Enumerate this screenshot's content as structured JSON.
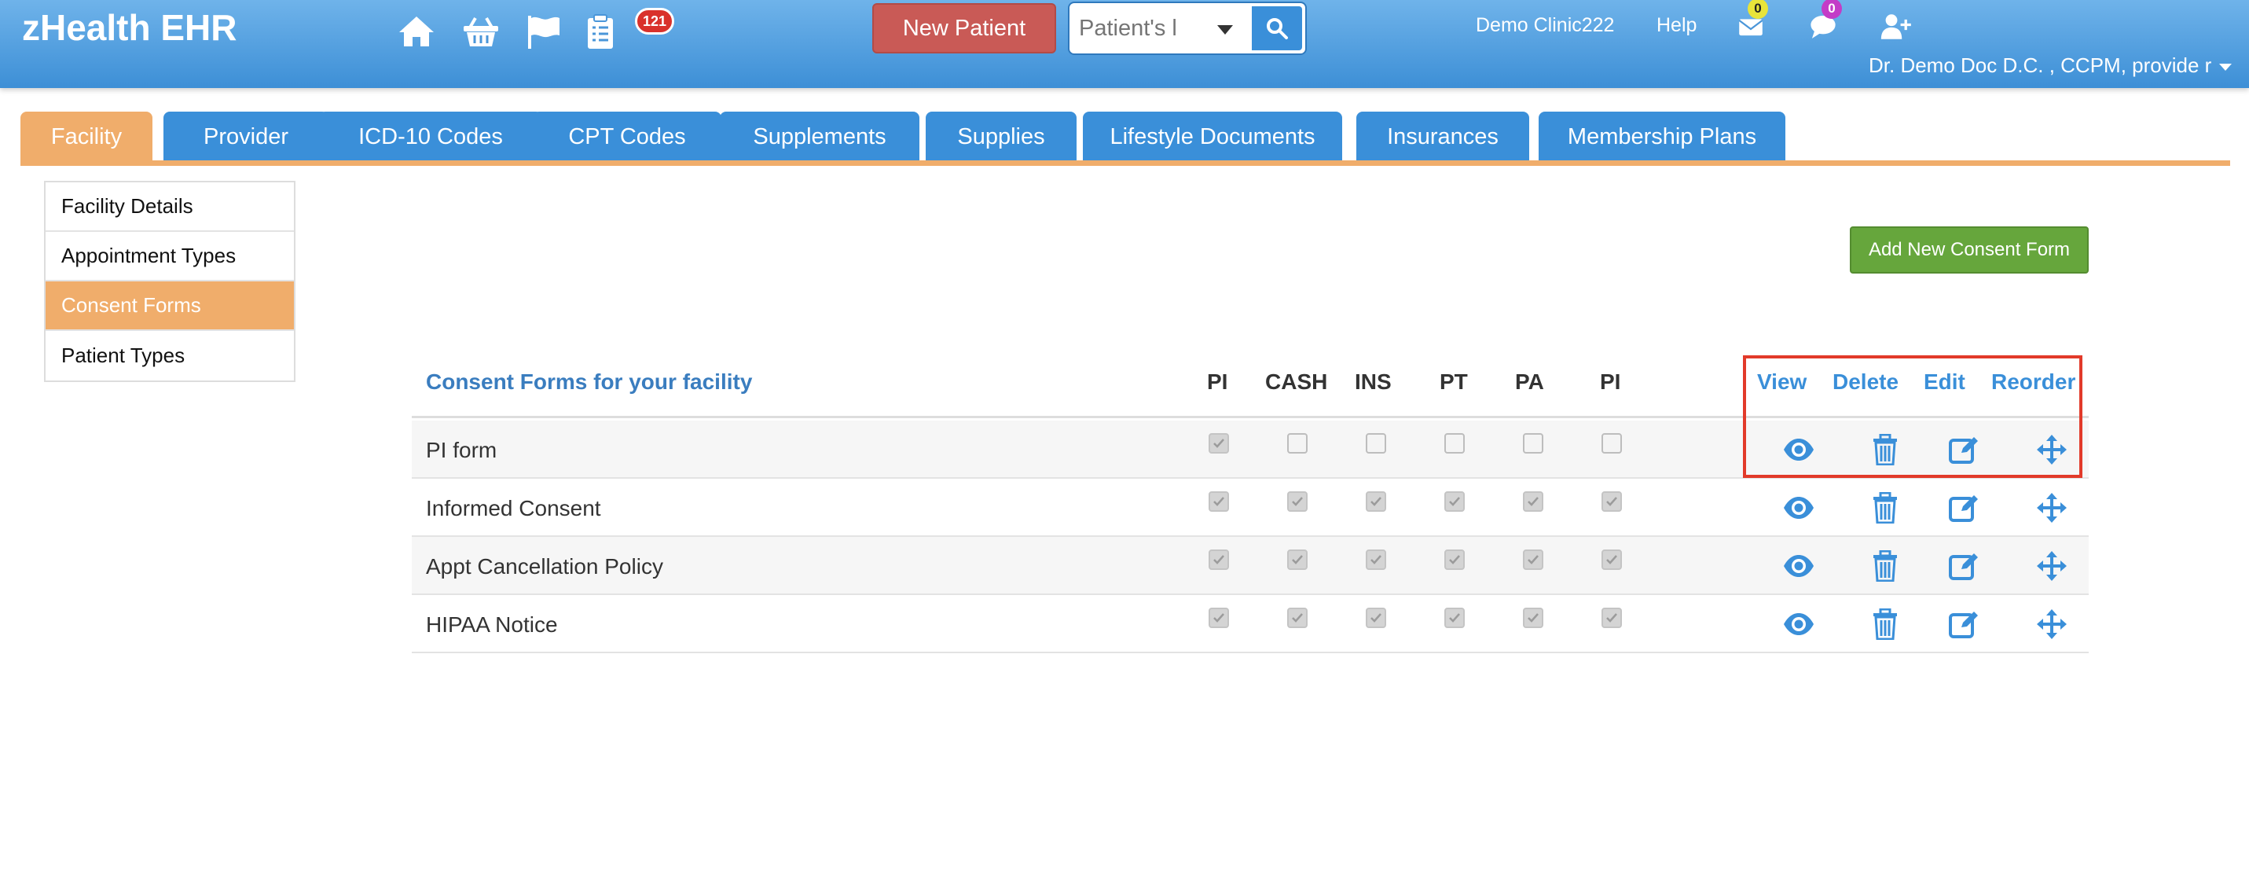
{
  "app": {
    "brand": "zHealth EHR"
  },
  "header": {
    "nav_icons": [
      "home-icon",
      "basket-icon",
      "flag-icon",
      "clipboard-icon"
    ],
    "tasks_badge": "121",
    "new_patient_label": "New Patient",
    "search_placeholder": "Patient's l",
    "clinic_label": "Demo Clinic222",
    "help_label": "Help",
    "messages_badge": "0",
    "chat_badge": "0",
    "user_label": "Dr. Demo Doc D.C. , CCPM, provide r"
  },
  "tabs": [
    {
      "label": "Facility",
      "active": true
    },
    {
      "label": "Provider",
      "active": false
    },
    {
      "label": "ICD-10 Codes",
      "active": false
    },
    {
      "label": "CPT Codes",
      "active": false
    },
    {
      "label": "Supplements",
      "active": false
    },
    {
      "label": "Supplies",
      "active": false
    },
    {
      "label": "Lifestyle Documents",
      "active": false
    },
    {
      "label": "Insurances",
      "active": false
    },
    {
      "label": "Membership Plans",
      "active": false
    }
  ],
  "sidemenu": [
    {
      "label": "Facility Details",
      "active": false
    },
    {
      "label": "Appointment Types",
      "active": false
    },
    {
      "label": "Consent Forms",
      "active": true
    },
    {
      "label": "Patient Types",
      "active": false
    }
  ],
  "add_button_label": "Add New Consent Form",
  "table": {
    "title": "Consent Forms for your facility",
    "columns": [
      "PI",
      "CASH",
      "INS",
      "PT",
      "PA",
      "PI"
    ],
    "action_columns": [
      "View",
      "Delete",
      "Edit",
      "Reorder"
    ],
    "rows": [
      {
        "name": "PI form",
        "checks": [
          true,
          false,
          false,
          false,
          false,
          false
        ]
      },
      {
        "name": "Informed Consent",
        "checks": [
          true,
          true,
          true,
          true,
          true,
          true
        ]
      },
      {
        "name": "Appt Cancellation Policy",
        "checks": [
          true,
          true,
          true,
          true,
          true,
          true
        ]
      },
      {
        "name": "HIPAA Notice",
        "checks": [
          true,
          true,
          true,
          true,
          true,
          true
        ]
      }
    ]
  },
  "colors": {
    "header_blue": "#3d8fd6",
    "tab_blue": "#3a8fd9",
    "accent_orange": "#f0ad6b",
    "new_patient_red": "#c95a56",
    "add_green": "#66a63c",
    "highlight_red": "#e23a2a"
  }
}
